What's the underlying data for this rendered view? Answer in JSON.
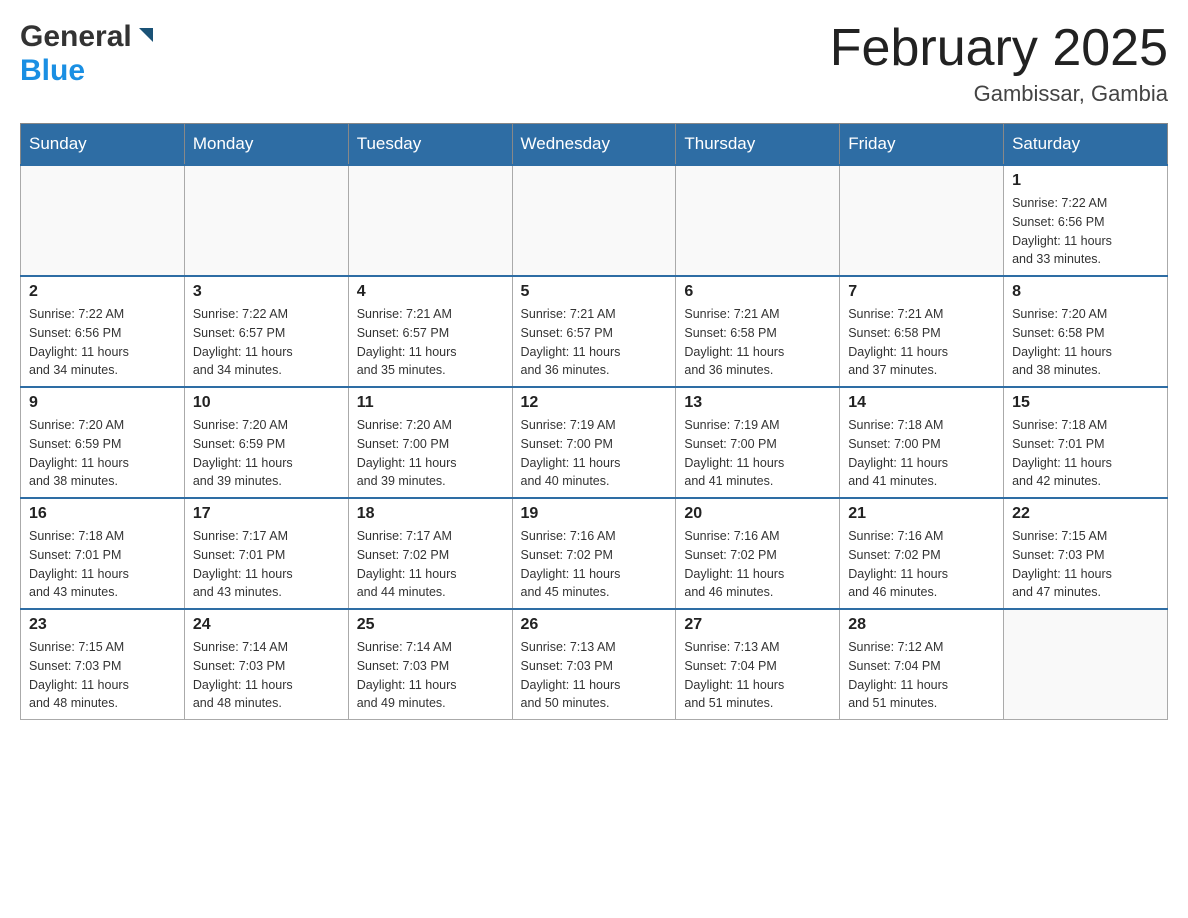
{
  "header": {
    "logo_general": "General",
    "logo_blue": "Blue",
    "month_title": "February 2025",
    "location": "Gambissar, Gambia"
  },
  "days_of_week": [
    "Sunday",
    "Monday",
    "Tuesday",
    "Wednesday",
    "Thursday",
    "Friday",
    "Saturday"
  ],
  "weeks": [
    [
      {
        "day": "",
        "info": ""
      },
      {
        "day": "",
        "info": ""
      },
      {
        "day": "",
        "info": ""
      },
      {
        "day": "",
        "info": ""
      },
      {
        "day": "",
        "info": ""
      },
      {
        "day": "",
        "info": ""
      },
      {
        "day": "1",
        "info": "Sunrise: 7:22 AM\nSunset: 6:56 PM\nDaylight: 11 hours\nand 33 minutes."
      }
    ],
    [
      {
        "day": "2",
        "info": "Sunrise: 7:22 AM\nSunset: 6:56 PM\nDaylight: 11 hours\nand 34 minutes."
      },
      {
        "day": "3",
        "info": "Sunrise: 7:22 AM\nSunset: 6:57 PM\nDaylight: 11 hours\nand 34 minutes."
      },
      {
        "day": "4",
        "info": "Sunrise: 7:21 AM\nSunset: 6:57 PM\nDaylight: 11 hours\nand 35 minutes."
      },
      {
        "day": "5",
        "info": "Sunrise: 7:21 AM\nSunset: 6:57 PM\nDaylight: 11 hours\nand 36 minutes."
      },
      {
        "day": "6",
        "info": "Sunrise: 7:21 AM\nSunset: 6:58 PM\nDaylight: 11 hours\nand 36 minutes."
      },
      {
        "day": "7",
        "info": "Sunrise: 7:21 AM\nSunset: 6:58 PM\nDaylight: 11 hours\nand 37 minutes."
      },
      {
        "day": "8",
        "info": "Sunrise: 7:20 AM\nSunset: 6:58 PM\nDaylight: 11 hours\nand 38 minutes."
      }
    ],
    [
      {
        "day": "9",
        "info": "Sunrise: 7:20 AM\nSunset: 6:59 PM\nDaylight: 11 hours\nand 38 minutes."
      },
      {
        "day": "10",
        "info": "Sunrise: 7:20 AM\nSunset: 6:59 PM\nDaylight: 11 hours\nand 39 minutes."
      },
      {
        "day": "11",
        "info": "Sunrise: 7:20 AM\nSunset: 7:00 PM\nDaylight: 11 hours\nand 39 minutes."
      },
      {
        "day": "12",
        "info": "Sunrise: 7:19 AM\nSunset: 7:00 PM\nDaylight: 11 hours\nand 40 minutes."
      },
      {
        "day": "13",
        "info": "Sunrise: 7:19 AM\nSunset: 7:00 PM\nDaylight: 11 hours\nand 41 minutes."
      },
      {
        "day": "14",
        "info": "Sunrise: 7:18 AM\nSunset: 7:00 PM\nDaylight: 11 hours\nand 41 minutes."
      },
      {
        "day": "15",
        "info": "Sunrise: 7:18 AM\nSunset: 7:01 PM\nDaylight: 11 hours\nand 42 minutes."
      }
    ],
    [
      {
        "day": "16",
        "info": "Sunrise: 7:18 AM\nSunset: 7:01 PM\nDaylight: 11 hours\nand 43 minutes."
      },
      {
        "day": "17",
        "info": "Sunrise: 7:17 AM\nSunset: 7:01 PM\nDaylight: 11 hours\nand 43 minutes."
      },
      {
        "day": "18",
        "info": "Sunrise: 7:17 AM\nSunset: 7:02 PM\nDaylight: 11 hours\nand 44 minutes."
      },
      {
        "day": "19",
        "info": "Sunrise: 7:16 AM\nSunset: 7:02 PM\nDaylight: 11 hours\nand 45 minutes."
      },
      {
        "day": "20",
        "info": "Sunrise: 7:16 AM\nSunset: 7:02 PM\nDaylight: 11 hours\nand 46 minutes."
      },
      {
        "day": "21",
        "info": "Sunrise: 7:16 AM\nSunset: 7:02 PM\nDaylight: 11 hours\nand 46 minutes."
      },
      {
        "day": "22",
        "info": "Sunrise: 7:15 AM\nSunset: 7:03 PM\nDaylight: 11 hours\nand 47 minutes."
      }
    ],
    [
      {
        "day": "23",
        "info": "Sunrise: 7:15 AM\nSunset: 7:03 PM\nDaylight: 11 hours\nand 48 minutes."
      },
      {
        "day": "24",
        "info": "Sunrise: 7:14 AM\nSunset: 7:03 PM\nDaylight: 11 hours\nand 48 minutes."
      },
      {
        "day": "25",
        "info": "Sunrise: 7:14 AM\nSunset: 7:03 PM\nDaylight: 11 hours\nand 49 minutes."
      },
      {
        "day": "26",
        "info": "Sunrise: 7:13 AM\nSunset: 7:03 PM\nDaylight: 11 hours\nand 50 minutes."
      },
      {
        "day": "27",
        "info": "Sunrise: 7:13 AM\nSunset: 7:04 PM\nDaylight: 11 hours\nand 51 minutes."
      },
      {
        "day": "28",
        "info": "Sunrise: 7:12 AM\nSunset: 7:04 PM\nDaylight: 11 hours\nand 51 minutes."
      },
      {
        "day": "",
        "info": ""
      }
    ]
  ]
}
